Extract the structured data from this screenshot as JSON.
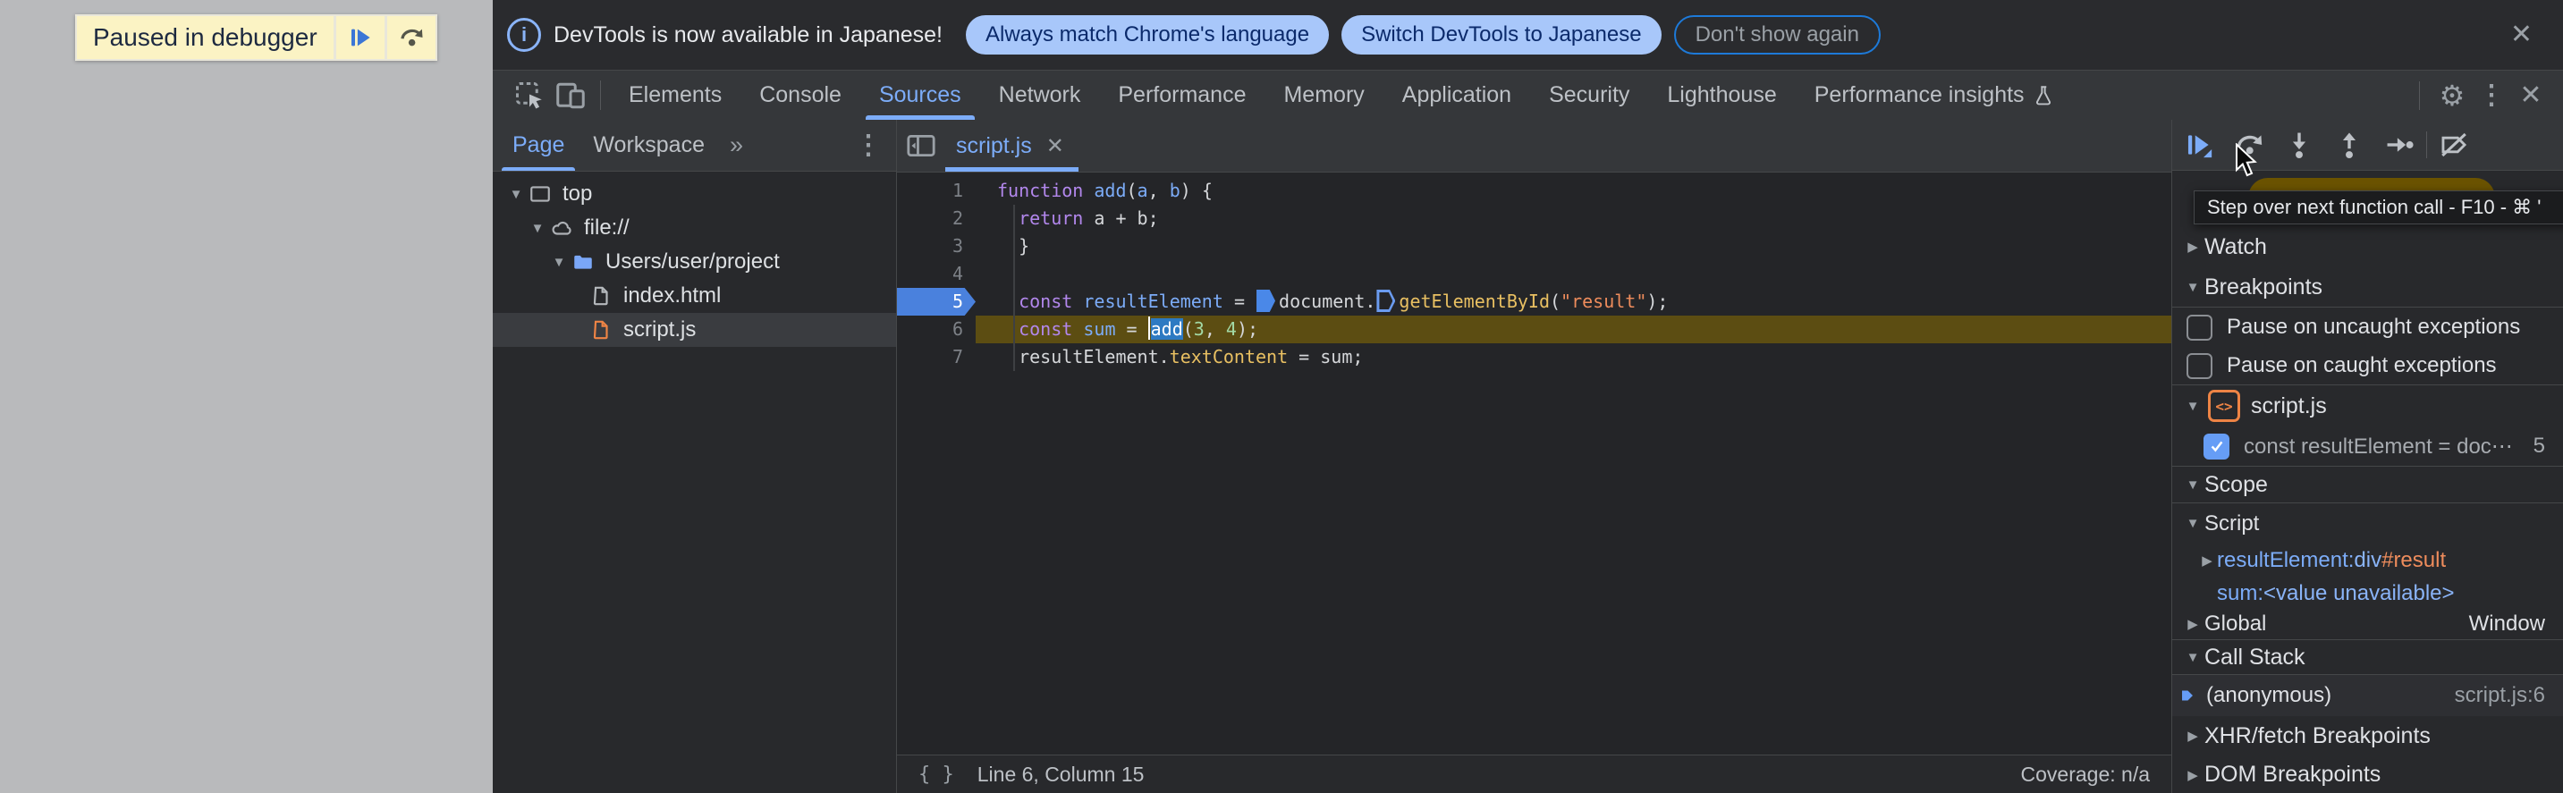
{
  "colors": {
    "accent_blue": "#7cacf8",
    "pill_button_bg": "#a8c7fa",
    "pill_button_text": "#0b2a6b",
    "paused_banner_bg": "#fbf3c4",
    "breakpoint_blue": "#4a81dd",
    "execution_line_bg": "#5c4d12",
    "debugger_paused_pill": "#6b5300"
  },
  "icons": {
    "collapsed": "▶",
    "expanded": "▼",
    "overflow": "»",
    "more": "⋮",
    "close": "✕",
    "gear": "⚙",
    "braces": "{ }",
    "info": "i",
    "code_tag": "<>"
  },
  "page": {
    "paused_banner": {
      "label": "Paused in debugger"
    }
  },
  "notification": {
    "message": "DevTools is now available in Japanese!",
    "primary_button": "Always match Chrome's language",
    "secondary_button": "Switch DevTools to Japanese",
    "dismiss_button": "Don't show again"
  },
  "toolbar": {
    "tabs": [
      "Elements",
      "Console",
      "Sources",
      "Network",
      "Performance",
      "Memory",
      "Application",
      "Security",
      "Lighthouse",
      "Performance insights"
    ],
    "active_tab": "Sources",
    "flask_tab": "Performance insights"
  },
  "navigator": {
    "tabs": [
      {
        "label": "Page"
      },
      {
        "label": "Workspace"
      }
    ],
    "tree": [
      {
        "label": "top"
      },
      {
        "label": "file://"
      },
      {
        "label": "Users/user/project"
      },
      {
        "label": "index.html"
      },
      {
        "label": "script.js"
      }
    ]
  },
  "editor": {
    "tab_label": "script.js",
    "breakpoint_line": 5,
    "active_line": 6,
    "lines": [
      {
        "num": 1,
        "tokens": [
          [
            "k",
            "function"
          ],
          [
            "p",
            " "
          ],
          [
            "f",
            "add"
          ],
          [
            "p",
            "("
          ],
          [
            "v",
            "a"
          ],
          [
            "p",
            ", "
          ],
          [
            "v",
            "b"
          ],
          [
            "p",
            ") {"
          ]
        ]
      },
      {
        "num": 2,
        "tokens": [
          [
            "p",
            "  "
          ],
          [
            "k",
            "return"
          ],
          [
            "p",
            " a + b;"
          ]
        ]
      },
      {
        "num": 3,
        "tokens": [
          [
            "p",
            "  }"
          ]
        ]
      },
      {
        "num": 4,
        "tokens": []
      },
      {
        "num": 5,
        "tokens": [
          [
            "p",
            "  "
          ],
          [
            "k",
            "const"
          ],
          [
            "p",
            " "
          ],
          [
            "v",
            "resultElement"
          ],
          [
            "p",
            " = "
          ],
          [
            "M",
            ""
          ],
          [
            "p",
            "document."
          ],
          [
            "H",
            ""
          ],
          [
            "m",
            "getElementById"
          ],
          [
            "p",
            "("
          ],
          [
            "s",
            "\"result\""
          ],
          [
            "p",
            ");"
          ]
        ]
      },
      {
        "num": 6,
        "tokens": [
          [
            "p",
            "  "
          ],
          [
            "k",
            "const"
          ],
          [
            "p",
            " "
          ],
          [
            "v",
            "sum"
          ],
          [
            "p",
            " = "
          ],
          [
            "C",
            ""
          ],
          [
            "S",
            "add"
          ],
          [
            "p",
            "("
          ],
          [
            "n",
            "3"
          ],
          [
            "p",
            ", "
          ],
          [
            "n",
            "4"
          ],
          [
            "p",
            ");"
          ]
        ]
      },
      {
        "num": 7,
        "tokens": [
          [
            "p",
            "  resultElement."
          ],
          [
            "m",
            "textContent"
          ],
          [
            "p",
            " = sum;"
          ]
        ]
      }
    ],
    "status": {
      "position": "Line 6, Column 15",
      "coverage": "Coverage: n/a"
    }
  },
  "debugger_pane": {
    "tooltip": "Step over next function call - F10 - ⌘ '",
    "watch": "Watch",
    "breakpoints": {
      "title": "Breakpoints",
      "pause_uncaught": "Pause on uncaught exceptions",
      "pause_caught": "Pause on caught exceptions",
      "file_group": "script.js",
      "entry": {
        "label": "const resultElement = doc⋯",
        "line": "5"
      }
    },
    "scope": {
      "title": "Scope",
      "script_group": "Script",
      "var1_name": "resultElement",
      "var1_sep": ": ",
      "var1_tag": "div",
      "var1_id": "#result",
      "var2_name": "sum",
      "var2_sep": ": ",
      "var2_value": "<value unavailable>",
      "global_label": "Global",
      "global_value": "Window"
    },
    "call_stack": {
      "title": "Call Stack",
      "frame": "(anonymous)",
      "location": "script.js:6"
    },
    "xhr_breakpoints": "XHR/fetch Breakpoints",
    "dom_breakpoints": "DOM Breakpoints"
  }
}
